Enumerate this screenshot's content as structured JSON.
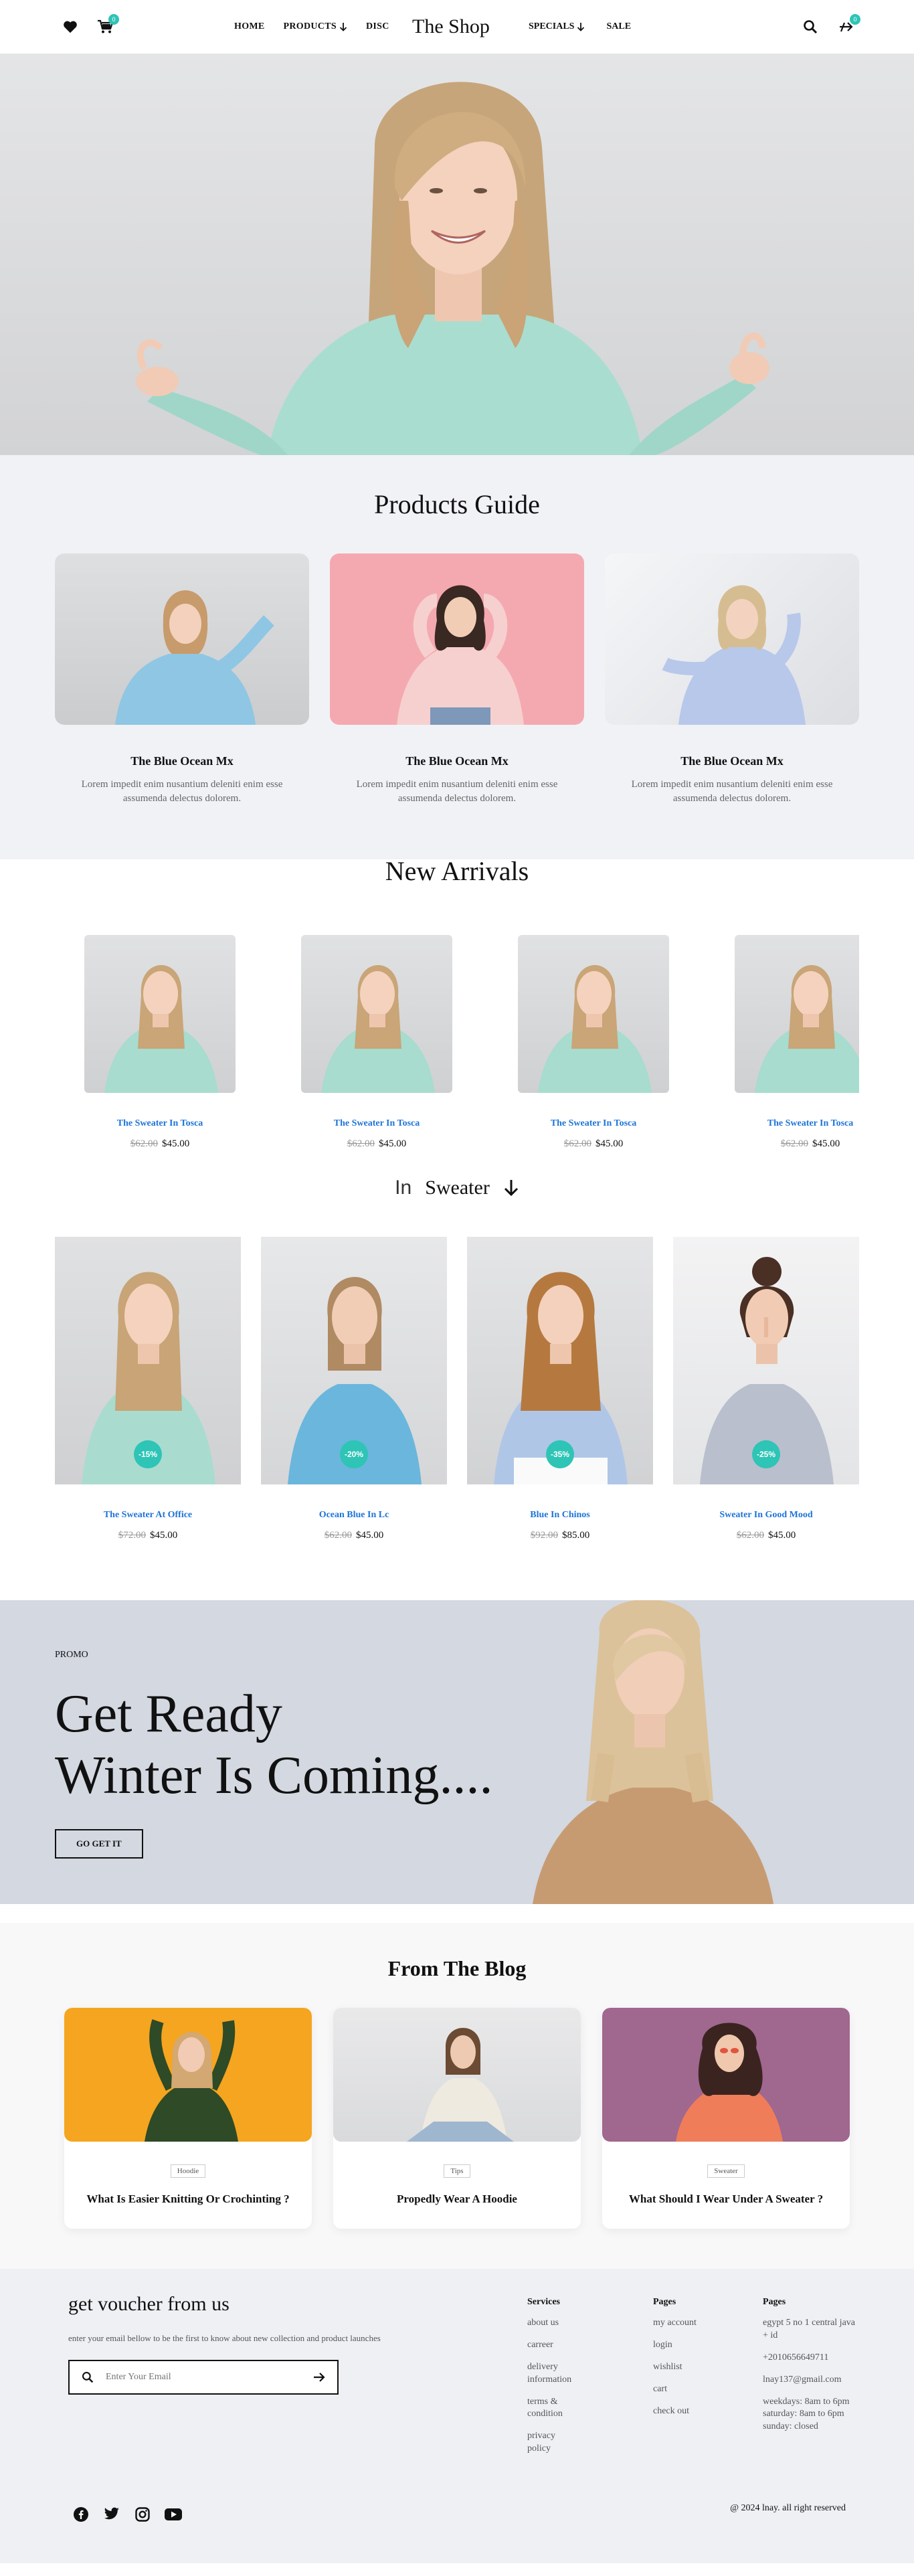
{
  "header": {
    "brand": "The Shop",
    "cart_count": "0",
    "compare_count": "0",
    "nav_left": [
      "HOME",
      "PRODUCTS",
      "DISC"
    ],
    "nav_right": [
      "SPECIALS",
      "SALE"
    ],
    "icons": [
      "heart-icon",
      "cart-icon",
      "search-icon",
      "compare-icon"
    ]
  },
  "guide": {
    "title": "Products Guide",
    "cards": [
      {
        "name": "The Blue Ocean Mx",
        "desc": "Lorem impedit enim nusantium deleniti enim esse assumenda delectus dolorem."
      },
      {
        "name": "The Blue Ocean Mx",
        "desc": "Lorem impedit enim nusantium deleniti enim esse assumenda delectus dolorem."
      },
      {
        "name": "The Blue Ocean Mx",
        "desc": "Lorem impedit enim nusantium deleniti enim esse assumenda delectus dolorem."
      }
    ]
  },
  "arrivals": {
    "title": "New Arrivals",
    "items": [
      {
        "name": "The Sweater In Tosca",
        "old": "$62.00",
        "price": "$45.00"
      },
      {
        "name": "The Sweater In Tosca",
        "old": "$62.00",
        "price": "$45.00"
      },
      {
        "name": "The Sweater In Tosca",
        "old": "$62.00",
        "price": "$45.00"
      },
      {
        "name": "The Sweater In Tosca",
        "old": "$62.00",
        "price": "$45.00"
      }
    ]
  },
  "filter": {
    "prefix": "In",
    "category": "Sweater"
  },
  "sweaters": [
    {
      "name": "The Sweater At Office",
      "old": "$72.00",
      "price": "$45.00",
      "discount": "-15%"
    },
    {
      "name": "Ocean Blue In Lc",
      "old": "$62.00",
      "price": "$45.00",
      "discount": "-20%"
    },
    {
      "name": "Blue In Chinos",
      "old": "$92.00",
      "price": "$85.00",
      "discount": "-35%"
    },
    {
      "name": "Sweater In Good Mood",
      "old": "$62.00",
      "price": "$45.00",
      "discount": "-25%"
    }
  ],
  "promo": {
    "tag": "PROMO",
    "line1": "Get Ready",
    "line2": "Winter Is Coming....",
    "button": "GO GET IT"
  },
  "blog": {
    "title": "From The Blog",
    "posts": [
      {
        "tag": "Hoodie",
        "title": "What Is Easier Knitting Or Crochinting ?"
      },
      {
        "tag": "Tips",
        "title": "Propedly Wear A Hoodie"
      },
      {
        "tag": "Sweater",
        "title": "What Should I Wear Under A Sweater ?"
      }
    ]
  },
  "footer": {
    "voucher_title": "get voucher from us",
    "voucher_text": "enter your email bellow to be the first to know about new collection and product launches",
    "email_placeholder": "Enter Your Email",
    "services": {
      "title": "Services",
      "items": [
        "about us",
        "carreer",
        "delivery information",
        "terms & condition",
        "privacy policy"
      ]
    },
    "pages": {
      "title": "Pages",
      "items": [
        "my account",
        "login",
        "wishlist",
        "cart",
        "check out"
      ]
    },
    "contact": {
      "title": "Pages",
      "address": "egypt 5 no 1 central java + id",
      "phone": "+2010656649711",
      "email": "lnay137@gmail.com",
      "hours1": "weekdays: 8am to 6pm",
      "hours2": "saturday: 8am to 6pm",
      "hours3": "sunday: closed"
    },
    "copyright": "@ 2024 lnay. all right reserved",
    "socials": [
      "facebook-icon",
      "twitter-icon",
      "instagram-icon",
      "youtube-icon"
    ]
  },
  "colors": {
    "accent": "#2ec4b6",
    "link": "#1e74d8",
    "promo_bg": "#d3d8e1",
    "guide_bg": "#f1f2f6"
  }
}
